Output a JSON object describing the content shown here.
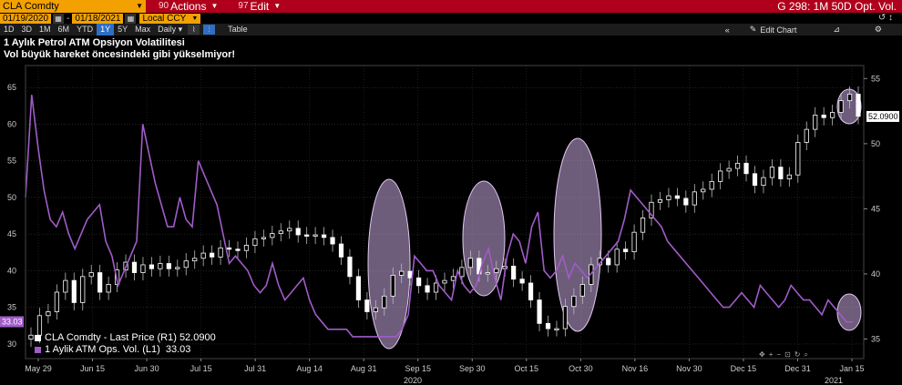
{
  "topbar": {
    "ticker": "CLA Comdty",
    "actions_num": "90",
    "actions_label": "Actions",
    "edit_num": "97",
    "edit_label": "Edit",
    "window_title": "G 298: 1M 50D Opt. Vol."
  },
  "datebar": {
    "start_date": "01/19/2020",
    "end_date": "01/18/2021",
    "currency": "Local CCY",
    "right_icons": "↺   ↕"
  },
  "toolbar": {
    "ranges": [
      "1D",
      "3D",
      "1M",
      "6M",
      "YTD",
      "1Y",
      "5Y",
      "Max"
    ],
    "active_range": "1Y",
    "frequency": "Daily",
    "table_label": "Table",
    "edit_chart_label": "Edit Chart"
  },
  "titles": {
    "line1": "1 Aylık Petrol ATM Opsiyon Volatilitesi",
    "line2": "Vol büyük hareket öncesindeki gibi yükselmiyor!"
  },
  "legend": {
    "price_label": "CLA Comdty - Last Price (R1)",
    "price_value": "52.0900",
    "vol_label": "1 Aylik ATM Ops. Vol. (L1)",
    "vol_value": "33.03"
  },
  "colors": {
    "vol_line": "#a05cc8",
    "candle": "#ffffff",
    "highlight": "#c8a8e0"
  },
  "chart_data": {
    "type": "line",
    "left_axis": {
      "ticks": [
        30,
        35,
        40,
        45,
        50,
        55,
        60,
        65
      ],
      "range": [
        28,
        68
      ]
    },
    "right_axis": {
      "ticks": [
        35,
        40,
        45,
        50,
        55
      ],
      "range": [
        33.5,
        56
      ]
    },
    "x_tick_labels": [
      "May 29",
      "Jun 15",
      "Jun 30",
      "Jul 15",
      "Jul 31",
      "Aug 14",
      "Aug 31",
      "Sep 15",
      "Sep 30",
      "Oct 15",
      "Oct 30",
      "Nov 16",
      "Nov 30",
      "Dec 15",
      "Dec 31",
      "Jan 15"
    ],
    "year_labels": [
      "2020",
      "2021"
    ],
    "left_last_value_label": "33.03",
    "right_last_value_label": "52.0900",
    "series": [
      {
        "name": "1 Aylik ATM Ops. Vol. (L1)",
        "axis": "left",
        "values": [
          50,
          64,
          57,
          51,
          47,
          46,
          48,
          45,
          43,
          45,
          47,
          48,
          49,
          44,
          42,
          38,
          40,
          42,
          44,
          60,
          56,
          52,
          49,
          46,
          46,
          50,
          47,
          46,
          55,
          53,
          51,
          49,
          45,
          41,
          42,
          41,
          40,
          38,
          37,
          38,
          41,
          38,
          36,
          37,
          38,
          39,
          36,
          34,
          33,
          32,
          32,
          32,
          32,
          31,
          31,
          31,
          31,
          31,
          31,
          31,
          31,
          32,
          34,
          42,
          41,
          40,
          40,
          38,
          37,
          36,
          40,
          38,
          37,
          38,
          41,
          43,
          39,
          36,
          42,
          45,
          44,
          41,
          46,
          48,
          40,
          39,
          40,
          42,
          39,
          41,
          40,
          39,
          40,
          41,
          42,
          43,
          44,
          47,
          51,
          50,
          49,
          48,
          47,
          46,
          44,
          43,
          42,
          41,
          40,
          39,
          38,
          37,
          36,
          35,
          35,
          36,
          37,
          36,
          35,
          38,
          37,
          36,
          35,
          36,
          38,
          37,
          36,
          36,
          35,
          34,
          36,
          35,
          34,
          33,
          33
        ]
      },
      {
        "name": "CLA Comdty - Last Price (R1)",
        "axis": "right",
        "values": [
          35.3,
          36.8,
          37.1,
          38.6,
          39.5,
          37.8,
          39.8,
          40.1,
          38.6,
          39.2,
          40.3,
          40.9,
          40.1,
          40.7,
          40.4,
          40.8,
          40.4,
          40.5,
          41.0,
          41.2,
          41.6,
          41.3,
          42.0,
          41.9,
          41.8,
          42.2,
          42.7,
          42.8,
          43.1,
          43.3,
          43.5,
          43.0,
          42.9,
          43.0,
          42.8,
          42.3,
          41.3,
          39.8,
          38.0,
          37.1,
          37.4,
          38.3,
          39.9,
          40.2,
          39.7,
          39.1,
          38.6,
          39.3,
          39.5,
          39.8,
          40.5,
          41.2,
          40.0,
          40.1,
          40.4,
          40.6,
          39.6,
          39.3,
          38.0,
          36.2,
          35.8,
          35.8,
          37.5,
          38.3,
          39.2,
          40.7,
          41.2,
          40.7,
          41.9,
          41.7,
          43.2,
          44.3,
          45.5,
          45.7,
          46.0,
          45.8,
          45.3,
          46.3,
          46.5,
          47.1,
          47.9,
          48.1,
          48.5,
          47.7,
          46.8,
          47.4,
          48.2,
          47.3,
          47.6,
          50.1,
          51.1,
          52.2,
          52.0,
          52.4,
          53.3,
          53.8,
          52.1
        ],
        "note_highlight_count": 5
      }
    ]
  }
}
